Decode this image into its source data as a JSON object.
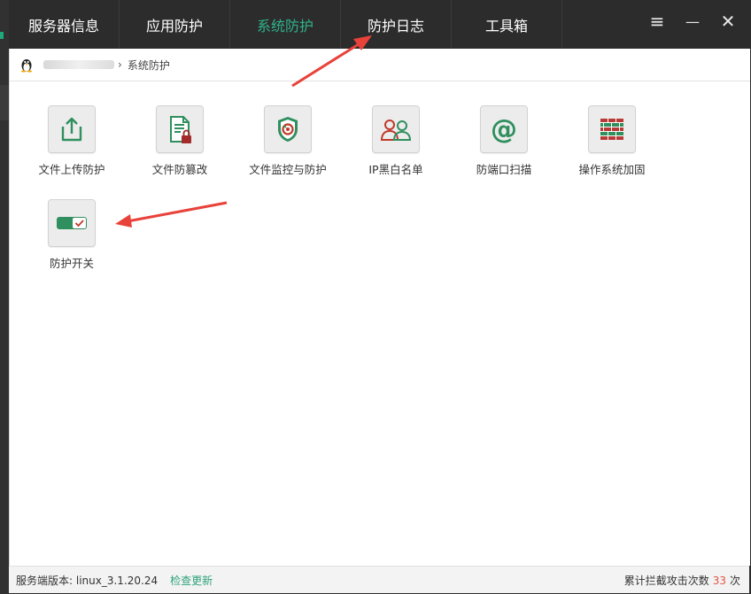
{
  "nav": {
    "tabs": [
      {
        "label": "服务器信息"
      },
      {
        "label": "应用防护"
      },
      {
        "label": "系统防护"
      },
      {
        "label": "防护日志"
      },
      {
        "label": "工具箱"
      }
    ],
    "active_tab": "系统防护",
    "accent_color": "#2fb38a"
  },
  "window_controls": {
    "menu": "≡",
    "minimize": "—",
    "close": "✕"
  },
  "breadcrumb": {
    "separator": "›",
    "current": "系统防护"
  },
  "tools": [
    {
      "label": "文件上传防护",
      "icon": "upload-icon"
    },
    {
      "label": "文件防篡改",
      "icon": "file-lock-icon"
    },
    {
      "label": "文件监控与防护",
      "icon": "shield-monitor-icon"
    },
    {
      "label": "IP黑白名单",
      "icon": "users-icon"
    },
    {
      "label": "防端口扫描",
      "icon": "at-icon"
    },
    {
      "label": "操作系统加固",
      "icon": "firewall-icon"
    },
    {
      "label": "防护开关",
      "icon": "toggle-icon"
    }
  ],
  "status": {
    "version_label": "服务端版本: linux_3.1.20.24",
    "check_update": "检查更新",
    "blocked_prefix": "累计拦截攻击次数",
    "blocked_count": "33",
    "blocked_suffix": "次"
  }
}
